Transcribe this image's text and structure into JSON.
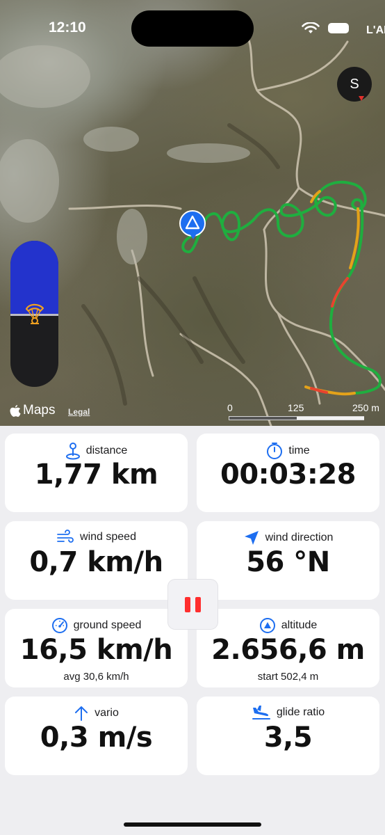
{
  "status_bar": {
    "time": "12:10",
    "carrier": "L'AR"
  },
  "map": {
    "compass_heading": "S",
    "maps_brand": "Maps",
    "legal_link": "Legal",
    "scale": {
      "labels": [
        "0",
        "125",
        "250 m"
      ]
    },
    "track_colors": {
      "climb": "#1fae3f",
      "sink_moderate": "#e3a21a",
      "sink_strong": "#e8432f"
    },
    "location_color": "#1d6ef0"
  },
  "altimeter": {
    "fill_fraction": 0.5,
    "fill_color": "#2333cc"
  },
  "stats": {
    "distance": {
      "label": "distance",
      "value": "1,77 km",
      "icon": "location-pin-icon"
    },
    "time": {
      "label": "time",
      "value": "00:03:28",
      "icon": "stopwatch-icon"
    },
    "wind_speed": {
      "label": "wind speed",
      "value": "0,7 km/h",
      "icon": "wind-icon"
    },
    "wind_direction": {
      "label": "wind direction",
      "value": "56 °N",
      "icon": "navigation-arrow-icon"
    },
    "ground_speed": {
      "label": "ground speed",
      "value": "16,5 km/h",
      "sub": "avg 30,6 km/h",
      "icon": "speedometer-icon"
    },
    "altitude": {
      "label": "altitude",
      "value": "2.656,6 m",
      "sub": "start 502,4 m",
      "icon": "triangle-circle-icon"
    },
    "vario": {
      "label": "vario",
      "value": "0,3 m/s",
      "icon": "up-arrow-icon"
    },
    "glide_ratio": {
      "label": "glide ratio",
      "value": "3,5",
      "icon": "airplane-landing-icon"
    }
  },
  "controls": {
    "pause_color": "#ff2e2e",
    "accent": "#1d6ef0"
  }
}
